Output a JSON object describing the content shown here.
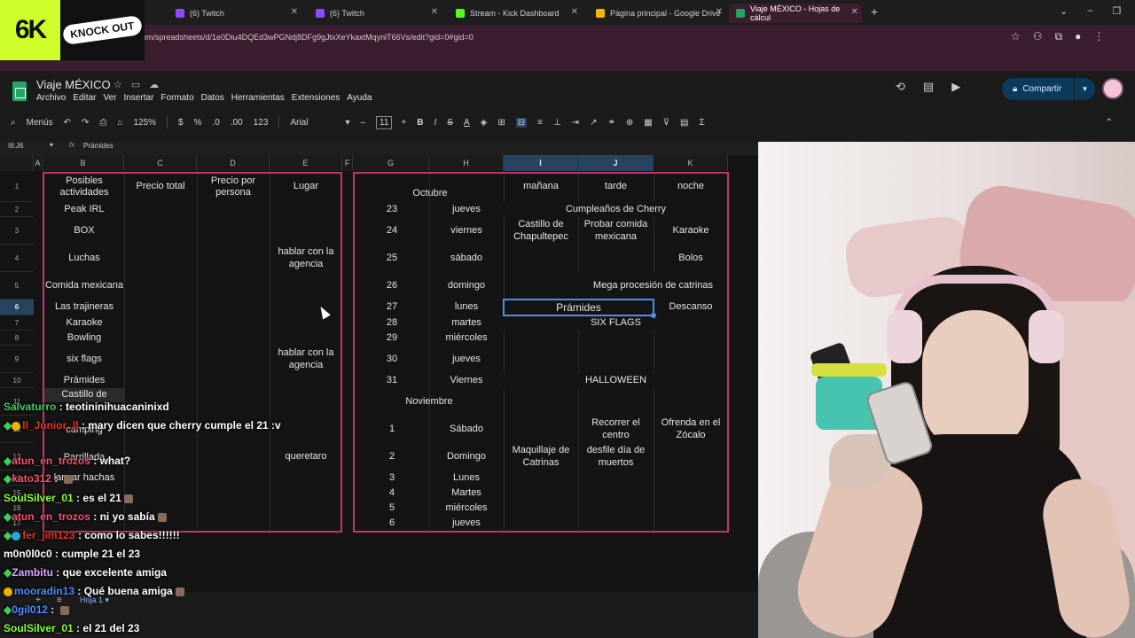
{
  "browser": {
    "tabs": [
      {
        "label": "(6) Twitch",
        "color": "#9146ff"
      },
      {
        "label": "(6) Twitch",
        "color": "#9146ff"
      },
      {
        "label": "Stream - Kick Dashboard",
        "color": "#53fc18"
      },
      {
        "label": "Página principal - Google Drive",
        "color": "#f4b400"
      },
      {
        "label": "Viaje MÉXICO - Hojas de cálcul",
        "color": "#22a565"
      }
    ],
    "new_tab": "+",
    "url": "om/spreadsheets/d/1e0Diu4DQEd3wPGNdj8DFg9gJtxXeYkaxtMqynlT66Vs/edit?gid=0#gid=0"
  },
  "overlay": {
    "logo_left": "6K",
    "logo_right": "KNOCK OUT"
  },
  "sheets": {
    "title": "Viaje MÉXICO",
    "menu": [
      "Archivo",
      "Editar",
      "Ver",
      "Insertar",
      "Formato",
      "Datos",
      "Herramientas",
      "Extensiones",
      "Ayuda"
    ],
    "share_label": "Compartir",
    "toolbar": {
      "menus": "Menús",
      "zoom": "125%",
      "currency": "$",
      "percent": "%",
      "dec_less": ".0",
      "dec_more": ".00",
      "number_format": "123",
      "font": "Arial",
      "font_size": "11",
      "bold": "B",
      "italic": "I",
      "strike": "S",
      "text_color": "A",
      "sum": "Σ"
    },
    "name_box": "I6:J6",
    "fx": "fx",
    "formula_value": "Prámides",
    "sheet_tab": "Hoja 1",
    "columns": [
      "A",
      "B",
      "C",
      "D",
      "E",
      "F",
      "G",
      "H",
      "I",
      "J",
      "K"
    ],
    "rows": [
      "1",
      "2",
      "3",
      "4",
      "5",
      "6",
      "7",
      "8",
      "9",
      "10",
      "11",
      "12",
      "13",
      "14",
      "15",
      "16",
      "17"
    ],
    "left_table": {
      "headers": [
        "Posibles actividades",
        "Precio total",
        "Precio por persona",
        "Lugar"
      ],
      "activities": [
        "Peak IRL",
        "BOX",
        "Luchas",
        "Comida mexicana",
        "Las trajineras",
        "Karaoke",
        "Bowling",
        "six flags",
        "Prámides",
        "Castillo de",
        "camping",
        "Parrillada",
        "lanzar hachas"
      ],
      "lugar": {
        "luchas": "hablar con la agencia",
        "six_flags": "hablar con la agencia",
        "parrillada": "queretaro"
      }
    },
    "right_table": {
      "headers": {
        "month1": "Octubre",
        "manana": "mañana",
        "tarde": "tarde",
        "noche": "noche",
        "month2": "Noviembre"
      },
      "days": [
        {
          "n": "23",
          "d": "jueves"
        },
        {
          "n": "24",
          "d": "viernes"
        },
        {
          "n": "25",
          "d": "sábado"
        },
        {
          "n": "26",
          "d": "domingo"
        },
        {
          "n": "27",
          "d": "lunes"
        },
        {
          "n": "28",
          "d": "martes"
        },
        {
          "n": "29",
          "d": "miércoles"
        },
        {
          "n": "30",
          "d": "jueves"
        },
        {
          "n": "31",
          "d": "Viernes"
        },
        {
          "n": "1",
          "d": "Sábado"
        },
        {
          "n": "2",
          "d": "Domingo"
        },
        {
          "n": "3",
          "d": "Lunes"
        },
        {
          "n": "4",
          "d": "Martes"
        },
        {
          "n": "5",
          "d": "miércoles"
        },
        {
          "n": "6",
          "d": "jueves"
        }
      ],
      "events": {
        "cumple": "Cumpleaños de Cherry",
        "castillo": "Castillo de Chapultepec",
        "comida": "Probar comida mexicana",
        "karaoke": "Karaoke",
        "bolos": "Bolos",
        "catrinas": "Mega procesión de catrinas",
        "piramides": "Prámides",
        "descanso": "Descanso",
        "sixflags": "SIX FLAGS",
        "halloween": "HALLOWEEN",
        "recorrer": "Recorrer el centro",
        "ofrenda": "Ofrenda en el Zócalo",
        "maquillaje": "Maquillaje de Catrinas",
        "desfile": "desfile día de muertos"
      }
    }
  },
  "chat": [
    {
      "user": "Salvaturro",
      "color": "#3ccf5a",
      "msg": "teotininihuacaninixd"
    },
    {
      "user": "ll_Junior_ll",
      "color": "#e0352f",
      "msg": "mary dicen que cherry cumple el 21 :v"
    },
    {
      "user": "atun_en_trozos",
      "color": "#ff4f6e",
      "msg": "what?"
    },
    {
      "user": "kato312",
      "color": "#ff4f6e",
      "msg": ""
    },
    {
      "user": "SoulSilver_01",
      "color": "#8bff3a",
      "msg": "es el 21"
    },
    {
      "user": "atun_en_trozos",
      "color": "#ff4f6e",
      "msg": "ni yo sabía"
    },
    {
      "user": "fer_jim123",
      "color": "#e0352f",
      "msg": "como lo sabes!!!!!!"
    },
    {
      "user": "m0n0l0c0",
      "color": "#ffffff",
      "msg": "cumple 21 el 23"
    },
    {
      "user": "Zambitu",
      "color": "#d9a6ff",
      "msg": "que excelente amiga"
    },
    {
      "user": "mooradin13",
      "color": "#4f8cff",
      "msg": "Qué buena amiga"
    },
    {
      "user": "0gil012",
      "color": "#4f8cff",
      "msg": ""
    },
    {
      "user": "SoulSilver_01",
      "color": "#8bff3a",
      "msg": "el 21 del 23"
    }
  ]
}
